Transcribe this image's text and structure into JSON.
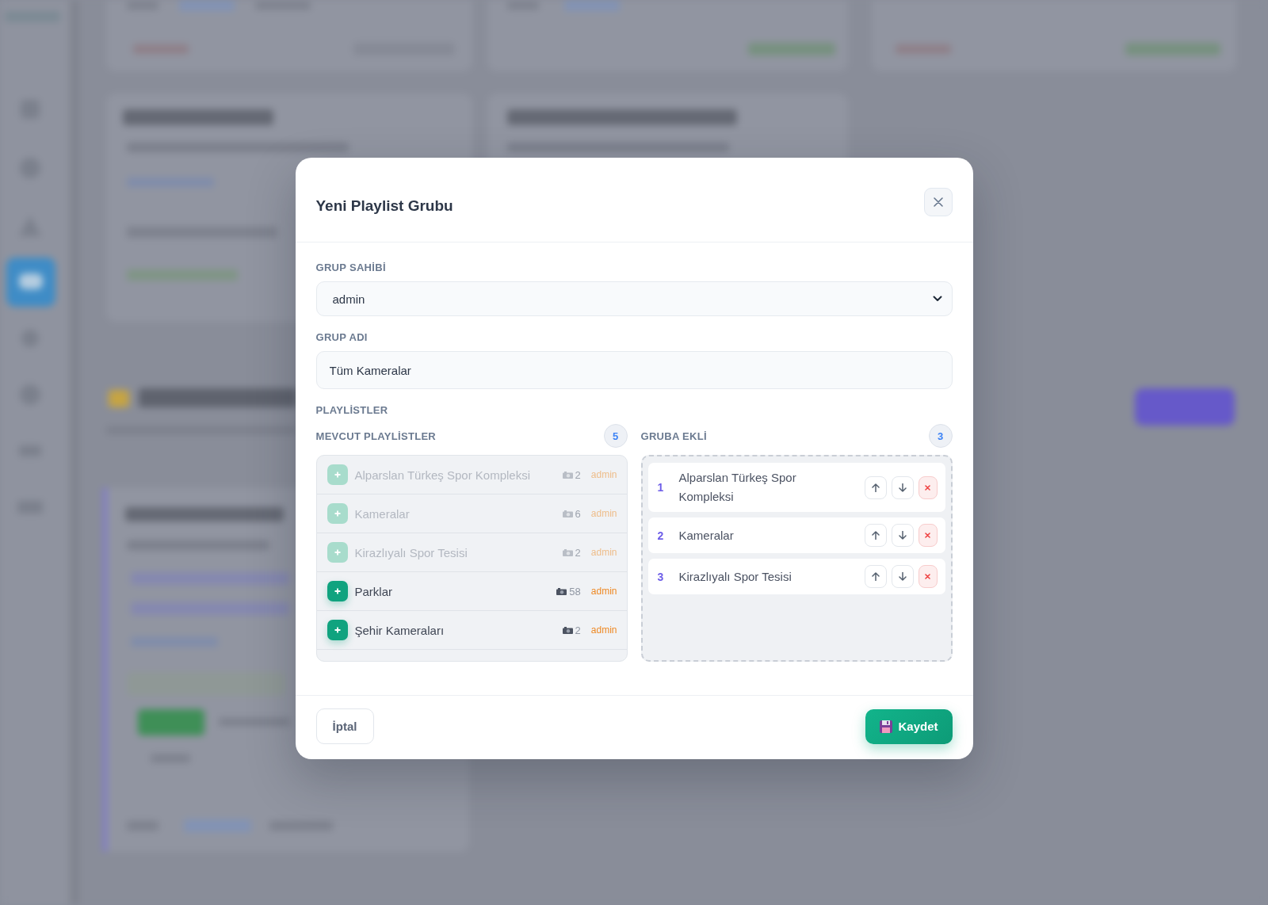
{
  "modal": {
    "title": "Yeni Playlist Grubu"
  },
  "owner_field": {
    "label": "GRUP SAHİBİ",
    "value": "admin"
  },
  "name_field": {
    "label": "GRUP ADI",
    "value": "Tüm Kameralar"
  },
  "playlists": {
    "label": "PLAYLİSTLER",
    "available": {
      "title": "MEVCUT PLAYLİSTLER",
      "count": "5",
      "items": [
        {
          "name": "Alparslan Türkeş Spor Kompleksi",
          "cameras": "2",
          "owner": "admin",
          "disabled": true
        },
        {
          "name": "Kameralar",
          "cameras": "6",
          "owner": "admin",
          "disabled": true
        },
        {
          "name": "Kirazlıyalı Spor Tesisi",
          "cameras": "2",
          "owner": "admin",
          "disabled": true
        },
        {
          "name": "Parklar",
          "cameras": "58",
          "owner": "admin",
          "disabled": false
        },
        {
          "name": "Şehir Kameraları",
          "cameras": "2",
          "owner": "admin",
          "disabled": false
        }
      ]
    },
    "added": {
      "title": "GRUBA EKLİ",
      "count": "3",
      "items": [
        {
          "number": "1",
          "name": "Alparslan Türkeş Spor Kompleksi"
        },
        {
          "number": "2",
          "name": "Kameralar"
        },
        {
          "number": "3",
          "name": "Kirazlıyalı Spor Tesisi"
        }
      ]
    }
  },
  "footer_buttons": [
    {
      "kind": "secondary",
      "label": "İptal"
    },
    {
      "kind": "primary",
      "label": "Kaydet"
    }
  ]
}
